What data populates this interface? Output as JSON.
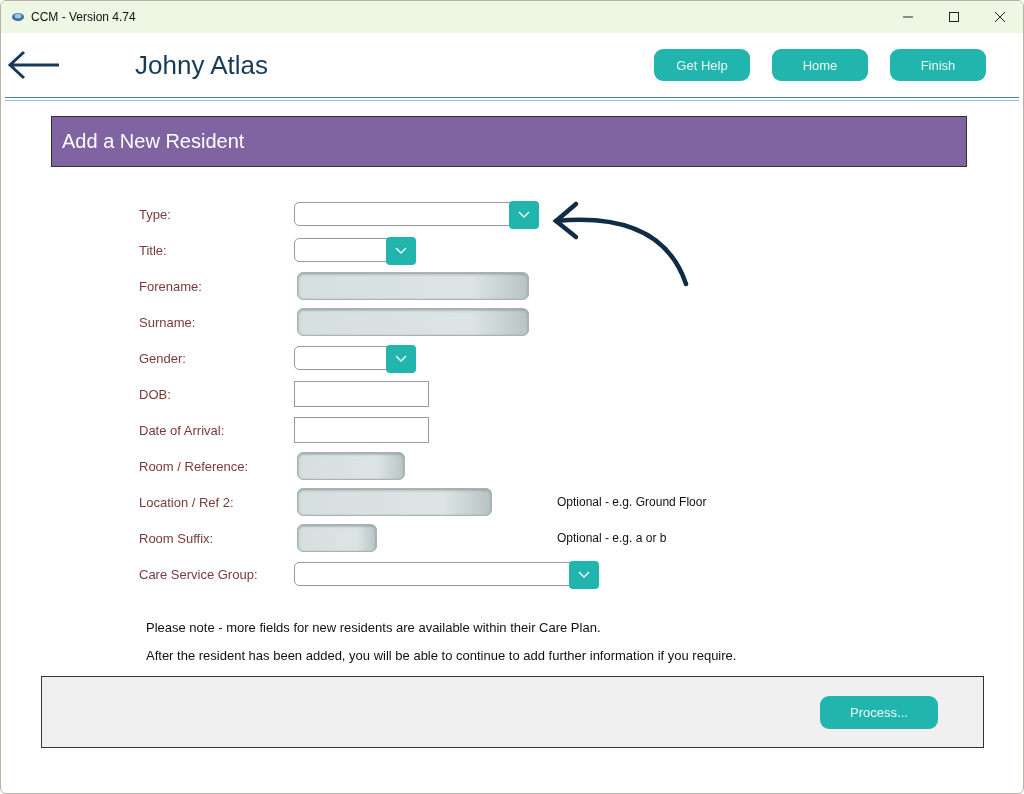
{
  "window": {
    "title": "CCM - Version 4.74"
  },
  "header": {
    "user_name": "Johny Atlas",
    "buttons": [
      "Get Help",
      "Home",
      "Finish"
    ]
  },
  "panel_title": "Add a New Resident",
  "fields": [
    {
      "label": "Type:",
      "kind": "dropdown"
    },
    {
      "label": "Title:",
      "kind": "dropdown"
    },
    {
      "label": "Forename:",
      "kind": "text"
    },
    {
      "label": "Surname:",
      "kind": "text"
    },
    {
      "label": "Gender:",
      "kind": "dropdown"
    },
    {
      "label": "DOB:",
      "kind": "date"
    },
    {
      "label": "Date of Arrival:",
      "kind": "date"
    },
    {
      "label": "Room / Reference:",
      "kind": "text"
    },
    {
      "label": "Location / Ref 2:",
      "kind": "text",
      "hint": "Optional - e.g. Ground Floor"
    },
    {
      "label": "Room Suffix:",
      "kind": "text",
      "hint": "Optional - e.g. a or b"
    },
    {
      "label": "Care Service Group:",
      "kind": "dropdown"
    }
  ],
  "notes": [
    "Please note - more fields for new residents are available within their Care Plan.",
    "After the resident has been added, you will be able to continue to add further information if you require."
  ],
  "footer": {
    "button": "Process..."
  }
}
